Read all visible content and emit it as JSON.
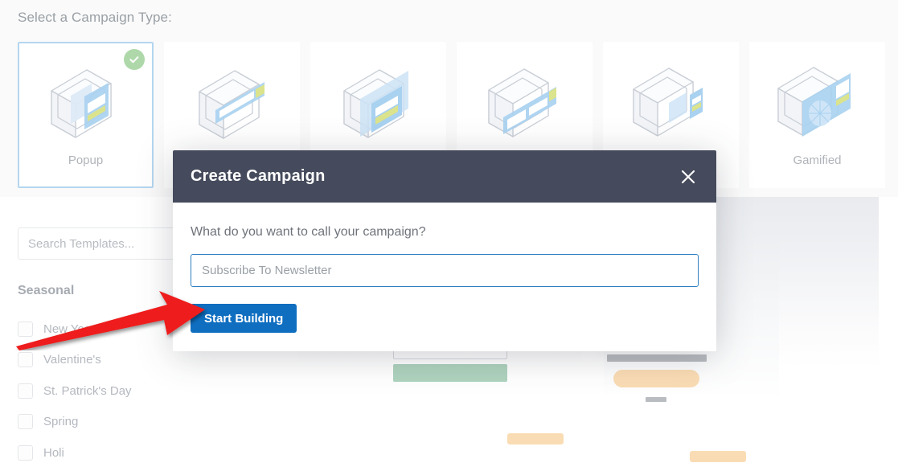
{
  "section": {
    "heading": "Select a Campaign Type:"
  },
  "campaign_types": [
    {
      "label": "Popup",
      "icon": "popup-artwork",
      "selected": true,
      "badge": "check-icon"
    },
    {
      "label": "",
      "icon": "floating-bar-artwork",
      "selected": false,
      "badge": ""
    },
    {
      "label": "",
      "icon": "fullscreen-artwork",
      "selected": false,
      "badge": ""
    },
    {
      "label": "",
      "icon": "slide-in-artwork",
      "selected": false,
      "badge": ""
    },
    {
      "label": "",
      "icon": "inline-artwork",
      "selected": false,
      "badge": ""
    },
    {
      "label": "Gamified",
      "icon": "gamified-artwork",
      "selected": false,
      "badge": ""
    }
  ],
  "sidebar": {
    "search_placeholder": "Search Templates...",
    "filter_group_title": "Seasonal",
    "filters": [
      {
        "label": "New Year's",
        "checked": false
      },
      {
        "label": "Valentine's",
        "checked": false
      },
      {
        "label": "St. Patrick's Day",
        "checked": false
      },
      {
        "label": "Spring",
        "checked": false
      },
      {
        "label": "Holi",
        "checked": false
      }
    ]
  },
  "modal": {
    "title": "Create Campaign",
    "close_icon": "close-icon",
    "question": "What do you want to call your campaign?",
    "input_value": "Subscribe To Newsletter",
    "input_placeholder": "Subscribe To Newsletter",
    "submit_label": "Start Building"
  },
  "annotation": {
    "type": "arrow",
    "color": "#ee1b1b",
    "points_to": "start-building-button"
  },
  "colors": {
    "modal_header": "#454b5c",
    "primary_button": "#0f6ec0",
    "input_focus_border": "#2f7ec0",
    "selected_card_border": "#b4d6f0",
    "check_badge": "#aed8a9",
    "page_background": "#fafafa",
    "annotation_red": "#ee1b1b"
  }
}
